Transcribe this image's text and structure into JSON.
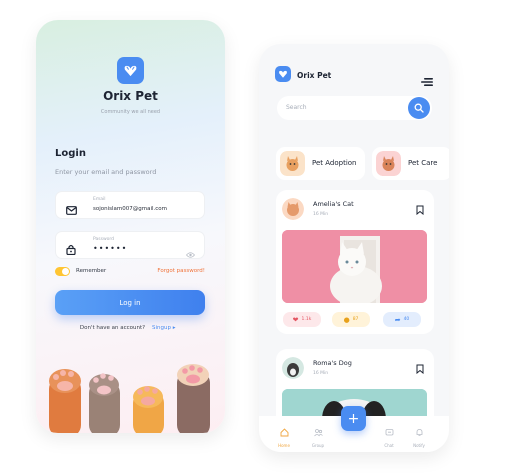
{
  "login": {
    "brand": "Orix Pet",
    "tagline": "Community we all need",
    "heading": "Login",
    "subheading": "Enter your email and password",
    "email_label": "Email",
    "email_value": "sojonislam007@gmail.com",
    "password_label": "Password",
    "password_mask": "••••••",
    "remember_label": "Remember",
    "forgot_label": "Forgot password!",
    "login_button": "Log in",
    "no_account": "Don't have an account?",
    "signup_label": "Singup ▸"
  },
  "feed": {
    "brand": "Orix Pet",
    "search_placeholder": "Search",
    "chips": [
      {
        "label": "Pet Adoption"
      },
      {
        "label": "Pet Care"
      }
    ],
    "posts": [
      {
        "name": "Amelia's Cat",
        "time": "16 Min",
        "likes": "1.1k",
        "comments": "87",
        "shares": "40"
      },
      {
        "name": "Roma's Dog",
        "time": "16 Min"
      }
    ],
    "nav": [
      {
        "label": "Home"
      },
      {
        "label": "Group"
      },
      {
        "label": "Chat"
      },
      {
        "label": "Notify"
      }
    ],
    "fab_label": "+"
  },
  "colors": {
    "accent": "#4a8cf1",
    "forgot": "#f0733a",
    "toggle": "#ffc533",
    "like": "#e45562",
    "comment": "#e8a11a"
  }
}
